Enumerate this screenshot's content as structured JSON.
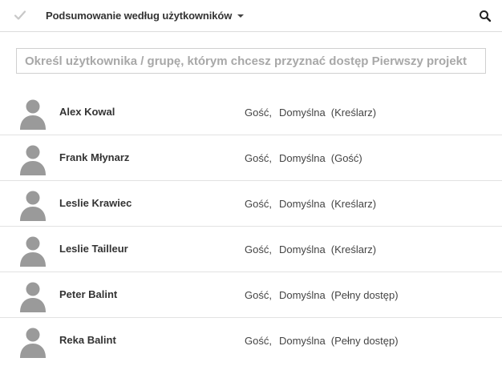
{
  "toolbar": {
    "title": "Podsumowanie według użytkowników",
    "check_icon": "check-icon",
    "caret_icon": "caret-down-icon",
    "search_icon": "search-icon"
  },
  "search": {
    "placeholder": "Określ użytkownika / grupę, którym chcesz przyznać dostęp Pierwszy projekt",
    "value": ""
  },
  "users": [
    {
      "name": "Alex Kowal",
      "type": "Gość,",
      "profile": "Domyślna",
      "role": "(Kreślarz)"
    },
    {
      "name": "Frank Młynarz",
      "type": "Gość,",
      "profile": "Domyślna",
      "role": "(Gość)"
    },
    {
      "name": "Leslie Krawiec",
      "type": "Gość,",
      "profile": "Domyślna",
      "role": "(Kreślarz)"
    },
    {
      "name": "Leslie Tailleur",
      "type": "Gość,",
      "profile": "Domyślna",
      "role": "(Kreślarz)"
    },
    {
      "name": "Peter Balint",
      "type": "Gość,",
      "profile": "Domyślna",
      "role": "(Pełny dostęp)"
    },
    {
      "name": "Reka Balint",
      "type": "Gość,",
      "profile": "Domyślna",
      "role": "(Pełny dostęp)"
    }
  ],
  "colors": {
    "avatar": "#9a9a9a",
    "check": "#c8c8c8",
    "divider": "#e2e2e2"
  }
}
